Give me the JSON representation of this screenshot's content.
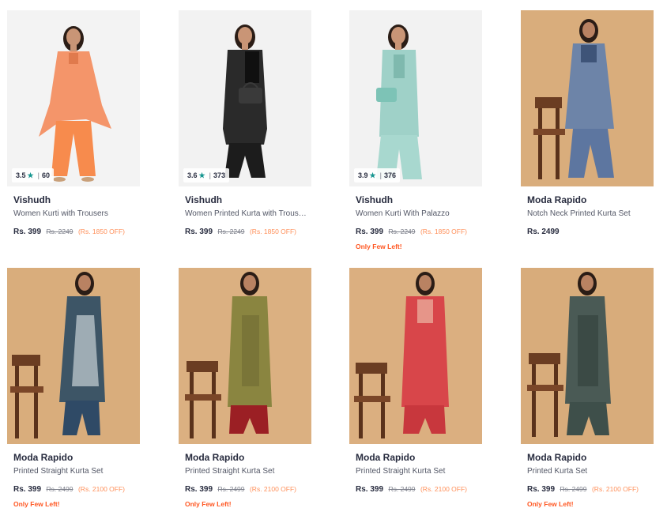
{
  "products": [
    {
      "brand": "Vishudh",
      "name": "Women Kurti with Trousers",
      "price": "Rs. 399",
      "mrp": "Rs. 2249",
      "discount": "(Rs. 1850 OFF)",
      "rating": "3.5",
      "rating_count": "60",
      "stock_note": "",
      "bg": "#f3f3f3",
      "top": "#f4956a",
      "top_dark": "#e07a4d",
      "bottom": "#f78b4d"
    },
    {
      "brand": "Vishudh",
      "name": "Women Printed Kurta with Trousers",
      "price": "Rs. 399",
      "mrp": "Rs. 2249",
      "discount": "(Rs. 1850 OFF)",
      "rating": "3.6",
      "rating_count": "373",
      "stock_note": "",
      "bg": "#f2f2f2",
      "top": "#2a2a2a",
      "top_dark": "#101010",
      "bottom": "#1c1c1c"
    },
    {
      "brand": "Vishudh",
      "name": "Women Kurti With Palazzo",
      "price": "Rs. 399",
      "mrp": "Rs. 2249",
      "discount": "(Rs. 1850 OFF)",
      "rating": "3.9",
      "rating_count": "376",
      "stock_note": "Only Few Left!",
      "bg": "#f2f2f2",
      "top": "#9fd1c8",
      "top_dark": "#7fb9ae",
      "bottom": "#a8d8cf"
    },
    {
      "brand": "Moda Rapido",
      "name": "Notch Neck Printed Kurta Set",
      "price": "Rs. 2499",
      "mrp": "",
      "discount": "",
      "rating": "",
      "rating_count": "",
      "stock_note": "",
      "bg": "#d9ad7c",
      "top": "#6d84a8",
      "top_dark": "#3e5478",
      "bottom": "#5d76a0"
    },
    {
      "brand": "Moda Rapido",
      "name": "Printed Straight Kurta Set",
      "price": "Rs. 399",
      "mrp": "Rs. 2499",
      "discount": "(Rs. 2100 OFF)",
      "rating": "",
      "rating_count": "",
      "stock_note": "Only Few Left!",
      "bg": "#d9ad7c",
      "top": "#3d5566",
      "top_dark": "#dfe6e8",
      "bottom": "#2f4a66"
    },
    {
      "brand": "Moda Rapido",
      "name": "Printed Straight Kurta Set",
      "price": "Rs. 399",
      "mrp": "Rs. 2499",
      "discount": "(Rs. 2100 OFF)",
      "rating": "",
      "rating_count": "",
      "stock_note": "Only Few Left!",
      "bg": "#dbb081",
      "top": "#8a8540",
      "top_dark": "#6a6530",
      "bottom": "#9b1f24"
    },
    {
      "brand": "Moda Rapido",
      "name": "Printed Straight Kurta Set",
      "price": "Rs. 399",
      "mrp": "Rs. 2499",
      "discount": "(Rs. 2100 OFF)",
      "rating": "",
      "rating_count": "",
      "stock_note": "",
      "bg": "#dbaf80",
      "top": "#d8464a",
      "top_dark": "#b83236",
      "bottom": "#c8373d"
    },
    {
      "brand": "Moda Rapido",
      "name": "Printed Kurta Set",
      "price": "Rs. 399",
      "mrp": "Rs. 2499",
      "discount": "(Rs. 2100 OFF)",
      "rating": "",
      "rating_count": "",
      "stock_note": "Only Few Left!",
      "bg": "#d8ac7b",
      "top": "#4a5a55",
      "top_dark": "#2c3a36",
      "bottom": "#3e4f4a"
    }
  ]
}
